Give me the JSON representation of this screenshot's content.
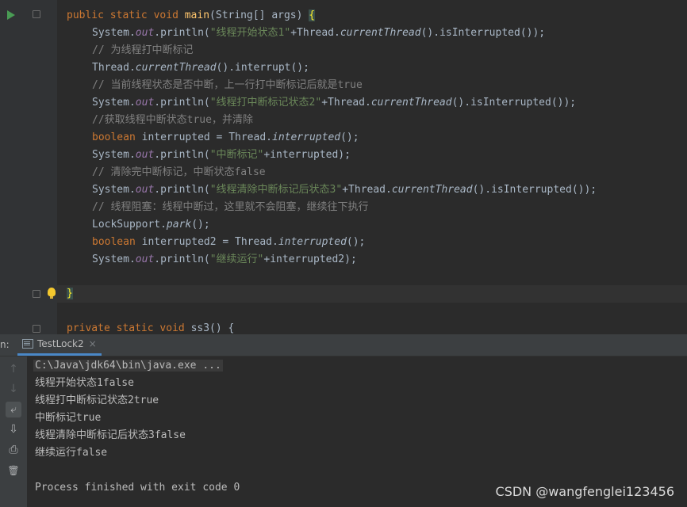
{
  "editor": {
    "lines": {
      "l1": [
        "public ",
        "static ",
        "void ",
        "main",
        "(String[] args) ",
        "{"
      ],
      "l2": [
        "System.",
        "out",
        ".println(",
        "\"线程开始状态1\"",
        "+Thread.",
        "currentThread",
        "().isInterrupted());"
      ],
      "l3": "// 为线程打中断标记",
      "l4": [
        "Thread.",
        "currentThread",
        "().interrupt();"
      ],
      "l5": "// 当前线程状态是否中断，上一行打中断标记后就是true",
      "l6": [
        "System.",
        "out",
        ".println(",
        "\"线程打中断标记状态2\"",
        "+Thread.",
        "currentThread",
        "().isInterrupted());"
      ],
      "l7": "//获取线程中断状态true，并清除",
      "l8": [
        "boolean ",
        "interrupted = Thread.",
        "interrupted",
        "();"
      ],
      "l9": [
        "System.",
        "out",
        ".println(",
        "\"中断标记\"",
        "+interrupted);"
      ],
      "l10": "// 清除完中断标记，中断状态false",
      "l11": [
        "System.",
        "out",
        ".println(",
        "\"线程清除中断标记后状态3\"",
        "+Thread.",
        "currentThread",
        "().isInterrupted());"
      ],
      "l12": "// 线程阻塞：线程中断过，这里就不会阻塞，继续往下执行",
      "l13": [
        "LockSupport.",
        "park",
        "();"
      ],
      "l14": [
        "boolean ",
        "interrupted2 = Thread.",
        "interrupted",
        "();"
      ],
      "l15": [
        "System.",
        "out",
        ".println(",
        "\"继续运行\"",
        "+interrupted2);"
      ],
      "l16": "}",
      "l17": [
        "private ",
        "static ",
        "void ",
        "ss3",
        "() {"
      ]
    }
  },
  "run_panel": {
    "left_label": "n:",
    "tab_label": "TestLock2",
    "tab_close": "×",
    "toolbar": {
      "up": "↑",
      "down": "↓",
      "wrap": "⤶",
      "scroll_end": "⇩",
      "print": "⎙",
      "trash": "🗑"
    },
    "command": "C:\\Java\\jdk64\\bin\\java.exe ...",
    "output": [
      "线程开始状态1false",
      "线程打中断标记状态2true",
      "中断标记true",
      "线程清除中断标记后状态3false",
      "继续运行false",
      "",
      "Process finished with exit code 0"
    ]
  },
  "watermark": "CSDN @wangfenglei123456"
}
